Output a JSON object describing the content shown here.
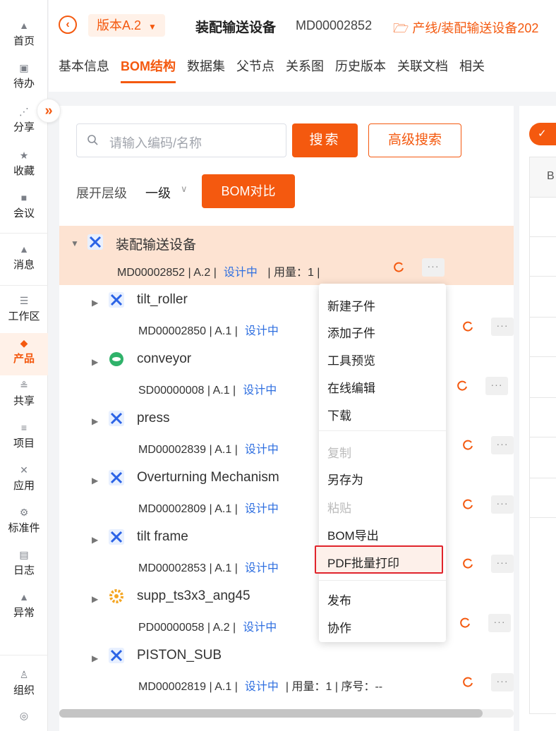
{
  "rail": {
    "items": [
      {
        "label": "首页",
        "icon": "home-icon"
      },
      {
        "label": "待办",
        "icon": "todo-icon"
      },
      {
        "label": "分享",
        "icon": "share-icon"
      },
      {
        "label": "收藏",
        "icon": "star-icon"
      },
      {
        "label": "会议",
        "icon": "video-icon"
      },
      {
        "label": "消息",
        "icon": "bell-icon"
      },
      {
        "label": "工作区",
        "icon": "workspace-icon"
      },
      {
        "label": "产品",
        "icon": "cube-icon"
      },
      {
        "label": "共享",
        "icon": "users-icon"
      },
      {
        "label": "项目",
        "icon": "database-icon"
      },
      {
        "label": "应用",
        "icon": "app-icon"
      },
      {
        "label": "标准件",
        "icon": "gear-icon"
      },
      {
        "label": "日志",
        "icon": "log-icon"
      },
      {
        "label": "异常",
        "icon": "warning-icon"
      },
      {
        "label": "组织",
        "icon": "org-icon"
      }
    ],
    "expand_glyph": "»"
  },
  "header": {
    "version": "版本A.2",
    "title": "装配输送设备",
    "code": "MD00002852",
    "path": "产线/装配输送设备202",
    "tabs": [
      "基本信息",
      "BOM结构",
      "数据集",
      "父节点",
      "关系图",
      "历史版本",
      "关联文档",
      "相关"
    ]
  },
  "toolbar": {
    "search_placeholder": "请输入编码/名称",
    "search_label": "搜索",
    "advanced_label": "高级搜索",
    "level_label": "展开层级",
    "level_value": "一级",
    "compare_label": "BOM对比"
  },
  "tree": {
    "root": {
      "name": "装配输送设备",
      "code": "MD00002852",
      "version": "A.2",
      "status": "设计中",
      "usage": "用量：1"
    },
    "children": [
      {
        "name": "tilt_roller",
        "code": "MD00002850",
        "version": "A.1",
        "status": "设计中",
        "icon": "assembly"
      },
      {
        "name": "conveyor",
        "code": "SD00000008",
        "version": "A.1",
        "status": "设计中",
        "icon": "part"
      },
      {
        "name": "press",
        "code": "MD00002839",
        "version": "A.1",
        "status": "设计中",
        "icon": "assembly"
      },
      {
        "name": "Overturning Mechanism",
        "code": "MD00002809",
        "version": "A.1",
        "status": "设计中",
        "icon": "assembly"
      },
      {
        "name": "tilt frame",
        "code": "MD00002853",
        "version": "A.1",
        "status": "设计中",
        "icon": "assembly"
      },
      {
        "name": "supp_ts3x3_ang45",
        "code": "PD00000058",
        "version": "A.2",
        "status": "设计中",
        "icon": "standard"
      },
      {
        "name": "PISTON_SUB",
        "code": "MD00002819",
        "version": "A.1",
        "status": "设计中",
        "icon": "assembly",
        "tail": "| 用量：1 | 序号：--"
      }
    ]
  },
  "context_menu": {
    "items": [
      {
        "label": "新建子件",
        "disabled": false
      },
      {
        "label": "添加子件",
        "disabled": false
      },
      {
        "label": "工具预览",
        "disabled": false
      },
      {
        "label": "在线编辑",
        "disabled": false
      },
      {
        "label": "下载",
        "disabled": false
      },
      {
        "label": "复制",
        "disabled": true
      },
      {
        "label": "另存为",
        "disabled": false
      },
      {
        "label": "粘贴",
        "disabled": true
      },
      {
        "label": "BOM导出",
        "disabled": false
      },
      {
        "label": "PDF批量打印",
        "disabled": false,
        "highlighted": true
      },
      {
        "label": "发布",
        "disabled": false
      },
      {
        "label": "协作",
        "disabled": false
      }
    ]
  },
  "right_panel": {
    "header_cell": "B"
  },
  "colors": {
    "accent": "#f4590f",
    "status": "#2f6fe0",
    "highlight": "#e0242c"
  }
}
